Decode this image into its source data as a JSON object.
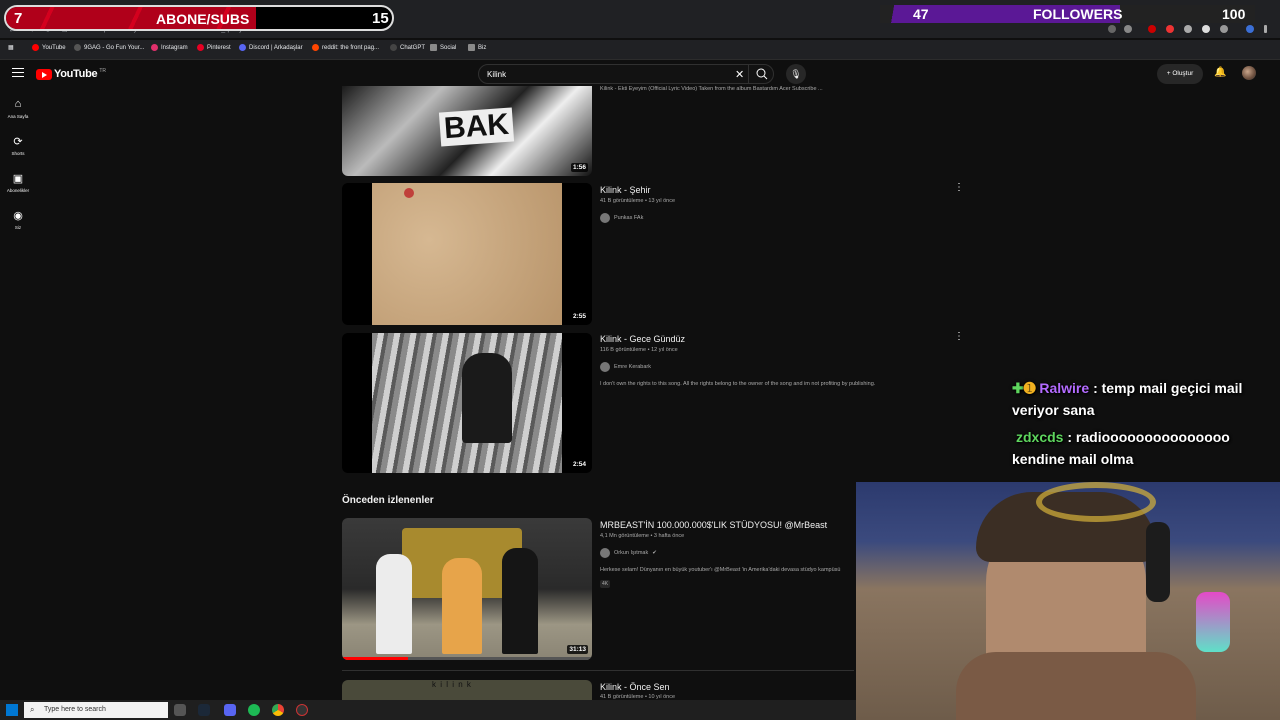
{
  "overlay": {
    "subs_current": "7",
    "subs_label": "ABONE/SUBS",
    "subs_goal": "15",
    "subs_progress_fraction": 0.47,
    "followers_current": "47",
    "followers_label": "FOLLOWERS",
    "followers_goal": "100"
  },
  "browser": {
    "url": "https://www.youtube.com/results?search_query=kilink",
    "bookmarks": [
      {
        "label": "YouTube",
        "color": "#ff0000"
      },
      {
        "label": "9GAG - Go Fun Your...",
        "color": "#333333"
      },
      {
        "label": "Instagram",
        "color": "#e1306c"
      },
      {
        "label": "Pinterest",
        "color": "#e60023"
      },
      {
        "label": "Discord | Arkadaşlar",
        "color": "#5865f2"
      },
      {
        "label": "reddit: the front pag...",
        "color": "#ff4500"
      },
      {
        "label": "ChatGPT",
        "color": "#202124"
      },
      {
        "label": "Social",
        "color": "#8a8a8a"
      },
      {
        "label": "Biz",
        "color": "#8a8a8a"
      }
    ]
  },
  "youtube": {
    "logo_text": "YouTube",
    "country_code": "TR",
    "search_value": "Kilink",
    "create_label": "+ Oluştur",
    "rail": [
      {
        "label": "Ana Sayfa",
        "icon": "home-icon"
      },
      {
        "label": "Shorts",
        "icon": "shorts-icon"
      },
      {
        "label": "Abonelikler",
        "icon": "subscriptions-icon"
      },
      {
        "label": "Siz",
        "icon": "you-icon"
      }
    ],
    "top_partial": {
      "description": "Kilink - Ekti Eyeyim (Official Lyric Video) Taken from the album Bastardım Acer Subscribe ...",
      "duration": "1:56"
    },
    "results": [
      {
        "title": "Kilink - Şehir",
        "views": "41 B görüntüleme",
        "age": "13 yıl önce",
        "channel": "Punkas FAk",
        "duration": "2:55",
        "description": ""
      },
      {
        "title": "Kilink - Gece Gündüz",
        "views": "116 B görüntüleme",
        "age": "12 yıl önce",
        "channel": "Emre Kerabark",
        "duration": "2:54",
        "description": "I don't own the rights to this song. All the rights belong to the owner of the song and im not profiting by publishing."
      }
    ],
    "section_title": "Önceden izlenenler",
    "watched": {
      "title": "MRBEAST'İN 100.000.000$'LIK STÜDYOSU! @MrBeast",
      "views": "4,1 Mn görüntüleme",
      "age": "3 hafta önce",
      "channel": "Orkun Işıtmak",
      "description": "Herkese selam! Dünyanın en büyük youtuber'ı @MrBeast 'in Amerika'daki devasa stüdyo kampüsü",
      "badge": "4K",
      "duration": "31:13",
      "watched_fraction": 0.26
    },
    "bottom_partial": {
      "title": "Kilink - Önce Sen",
      "views": "41 B görüntüleme",
      "age": "10 yıl önce",
      "thumb_text": "k i l i n k"
    }
  },
  "chat": [
    {
      "user": "Ralwire",
      "message": ": temp mail geçici mail veriyor sana"
    },
    {
      "user": "zdxcds",
      "message": ": radiooooooooooooooo kendine mail olma"
    }
  ],
  "taskbar": {
    "search_placeholder": "Type here to search"
  },
  "colors": {
    "yt_bg": "#0f0f0f",
    "subs_bar": "#c8001c",
    "followers_bar": "#5b1896",
    "chat_user1": "#b36bff",
    "chat_user2": "#5ed65e"
  }
}
